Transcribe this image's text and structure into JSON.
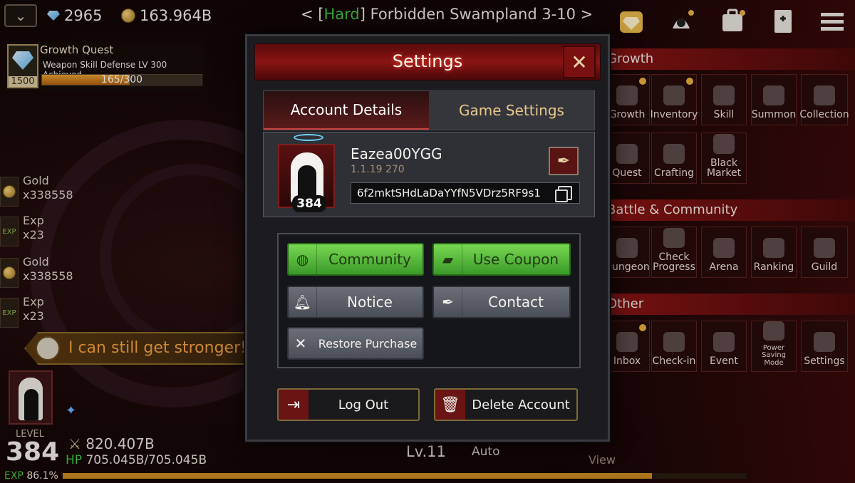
{
  "hud": {
    "gems": "2965",
    "gold": "163.964B",
    "stage_prefix": "< [",
    "stage_difficulty": "Hard",
    "stage_suffix": "] Forbidden Swampland 3-10 >"
  },
  "quest": {
    "title": "Growth Quest",
    "description": "Weapon Skill Defense LV 300 Achieved",
    "reward": "1500",
    "progress_text": "165/300",
    "progress": 0.55
  },
  "loot": [
    {
      "name": "Gold",
      "count": "x338558",
      "icon": "coin-icon"
    },
    {
      "name": "Exp",
      "count": "x23",
      "icon": "exp-icon"
    },
    {
      "name": "Gold",
      "count": "x338558",
      "icon": "coin-icon"
    },
    {
      "name": "Exp",
      "count": "x23",
      "icon": "exp-icon"
    }
  ],
  "speech": "I can still get stronger!",
  "player": {
    "level_label": "LEVEL",
    "level": "384",
    "exp_label": "EXP",
    "exp_value": "86.1%",
    "exp_progress": 0.861,
    "power": "820.407B",
    "hp_label": "HP",
    "hp_value": "705.045B/705.045B"
  },
  "bottom": {
    "level": "Lv.11",
    "auto": "Auto",
    "view": "View"
  },
  "right_panel": {
    "sections": [
      {
        "title": "Growth",
        "items": [
          "Growth",
          "Inventory",
          "Skill",
          "Summon",
          "Collection",
          "Quest",
          "Crafting",
          "Black Market"
        ]
      },
      {
        "title": "Battle & Community",
        "items": [
          "Dungeon",
          "Check Progress",
          "Arena",
          "Ranking",
          "Guild"
        ]
      },
      {
        "title": "Other",
        "items": [
          "Inbox",
          "Check-in",
          "Event",
          "Power Saving Mode",
          "Settings"
        ]
      }
    ]
  },
  "settings": {
    "title": "Settings",
    "tabs": [
      "Account Details",
      "Game Settings"
    ],
    "active_tab": "Account Details",
    "profile": {
      "name": "Eazea00YGG",
      "version": "1.1.19 270",
      "level": "384",
      "account_id": "6f2mktSHdLaDaYYfN5VDrz5RF9s1"
    },
    "buttons": {
      "community": "Community",
      "use_coupon": "Use Coupon",
      "notice": "Notice",
      "contact": "Contact",
      "restore_purchase": "Restore Purchase"
    },
    "footer": {
      "logout": "Log Out",
      "delete_account": "Delete Account"
    }
  },
  "colors": {
    "accent_red": "#8a1414",
    "green": "#3ec83e",
    "gold": "#e8c88a"
  }
}
